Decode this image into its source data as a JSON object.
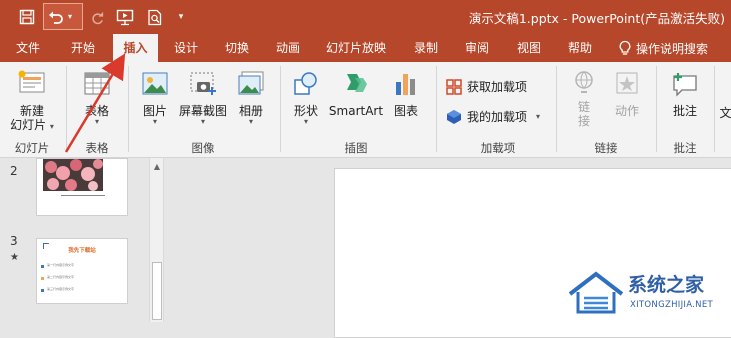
{
  "title_bar": {
    "title": "演示文稿1.pptx  -  PowerPoint(产品激活失败)"
  },
  "menu": {
    "tabs": [
      "文件",
      "开始",
      "插入",
      "设计",
      "切换",
      "动画",
      "幻灯片放映",
      "录制",
      "审阅",
      "视图",
      "帮助"
    ],
    "active": "插入",
    "tell_me": "操作说明搜索"
  },
  "ribbon": {
    "slides": {
      "new_slide_line1": "新建",
      "new_slide_line2": "幻灯片",
      "label": "幻灯片"
    },
    "tables": {
      "table": "表格",
      "label": "表格"
    },
    "images": {
      "pictures": "图片",
      "screenshot": "屏幕截图",
      "album": "相册",
      "label": "图像"
    },
    "illustrations": {
      "shapes": "形状",
      "smartart": "SmartArt",
      "chart": "图表",
      "label": "插图"
    },
    "addins": {
      "get": "获取加载项",
      "mine": "我的加载项",
      "label": "加载项"
    },
    "links": {
      "link_line1": "链",
      "link_line2": "接",
      "action": "动作",
      "label": "链接"
    },
    "comments": {
      "comment": "批注",
      "label": "批注"
    },
    "text": {
      "partial": "文"
    }
  },
  "thumbnails": {
    "slide2_number": "2",
    "slide3_number": "3",
    "slide3_title": "我先下载站",
    "slide3_rows": [
      "第一行内容示例文字",
      "第二行内容示例文字",
      "第三行内容示例文字"
    ]
  },
  "watermark": {
    "name": "系统之家",
    "url": "XITONGZHIJIA.NET"
  },
  "colors": {
    "accent": "#b7472a",
    "ribbon": "#f3f3f3",
    "arrow": "#d93a2b"
  }
}
